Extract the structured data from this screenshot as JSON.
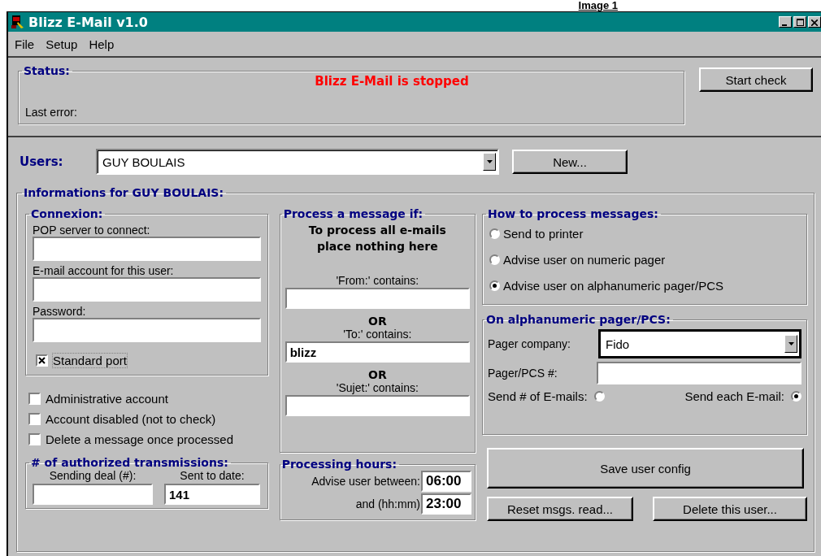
{
  "caption": "Image 1",
  "window": {
    "title": "Blizz E-Mail v1.0"
  },
  "menu": [
    {
      "label": "File"
    },
    {
      "label": "Setup"
    },
    {
      "label": "Help"
    }
  ],
  "status": {
    "title": "Status:",
    "message": "Blizz E-Mail is stopped",
    "last_error_label": "Last error:"
  },
  "start_button": "Start check",
  "users": {
    "label": "Users:",
    "value": "GUY BOULAIS",
    "new_button": "New..."
  },
  "info": {
    "title": "Informations for GUY BOULAIS:",
    "connexion": {
      "title": "Connexion:",
      "fields": [
        {
          "label": "POP server to connect:"
        },
        {
          "label": "E-mail account for this user:"
        },
        {
          "label": "Password:"
        }
      ],
      "standard_port": {
        "label": "Standard port",
        "checked": true
      }
    },
    "options": [
      {
        "label": "Administrative account",
        "checked": false
      },
      {
        "label": "Account disabled (not to check)",
        "checked": false
      },
      {
        "label": "Delete a message once processed",
        "checked": false
      }
    ],
    "transmissions": {
      "title": "# of authorized transmissions:",
      "fields": [
        {
          "label": "Sending deal (#):"
        },
        {
          "label": "Sent to date:",
          "value": "141"
        }
      ]
    },
    "filter": {
      "title": "Process a message if:",
      "note_lines": [
        "To process all e-mails",
        "place nothing here"
      ],
      "fields": [
        {
          "label": "'From:' contains:"
        },
        {
          "or": "OR",
          "label": "'To:' contains:",
          "value": "blizz"
        },
        {
          "or": "OR",
          "label": "'Sujet:' contains:"
        }
      ]
    },
    "hours": {
      "title": "Processing hours:",
      "rows": [
        {
          "label": "Advise user between:",
          "value": "06:00"
        },
        {
          "label": "and (hh:mm)",
          "value": "23:00"
        }
      ]
    },
    "process": {
      "title": "How to process messages:",
      "options": [
        {
          "label": "Send to printer",
          "selected": false
        },
        {
          "label": "Advise user on numeric pager",
          "selected": false
        },
        {
          "label": "Advise user on alphanumeric pager/PCS",
          "selected": true
        }
      ]
    },
    "pager": {
      "title": "On alphanumeric pager/PCS:",
      "company_label": "Pager company:",
      "company": "Fido",
      "number_label": "Pager/PCS #:",
      "send_modes": [
        {
          "label": "Send # of E-mails:",
          "selected": false
        },
        {
          "label": "Send each E-mail:",
          "selected": true
        }
      ]
    },
    "buttons": {
      "save": "Save user config",
      "reset": "Reset msgs. read...",
      "delete": "Delete this user..."
    }
  }
}
